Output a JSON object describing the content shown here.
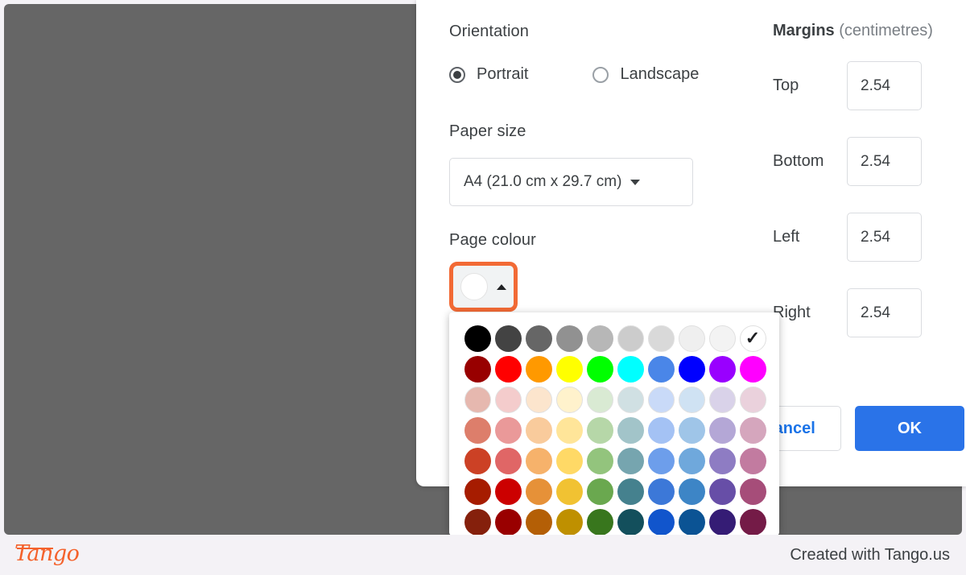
{
  "dialog": {
    "orientation": {
      "label": "Orientation",
      "options": [
        {
          "label": "Portrait",
          "selected": true
        },
        {
          "label": "Landscape",
          "selected": false
        }
      ]
    },
    "paper_size": {
      "label": "Paper size",
      "value": "A4 (21.0 cm x 29.7 cm)"
    },
    "page_colour": {
      "label": "Page colour",
      "current_colour": "#ffffff"
    },
    "margins": {
      "title_bold": "Margins",
      "title_unit": " (centimetres)",
      "fields": [
        {
          "label": "Top",
          "value": "2.54"
        },
        {
          "label": "Bottom",
          "value": "2.54"
        },
        {
          "label": "Left",
          "value": "2.54"
        },
        {
          "label": "Right",
          "value": "2.54"
        }
      ]
    },
    "buttons": {
      "cancel": "Cancel",
      "ok": "OK"
    }
  },
  "palette": {
    "selected_index": 9,
    "check_glyph": "✓",
    "rows": [
      [
        "#000000",
        "#434343",
        "#666666",
        "#919191",
        "#b7b7b7",
        "#cccccc",
        "#d9d9d9",
        "#efefef",
        "#f3f3f3",
        "#ffffff"
      ],
      [
        "#980000",
        "#ff0000",
        "#ff9900",
        "#ffff00",
        "#00ff00",
        "#00ffff",
        "#4a86e8",
        "#0000ff",
        "#9900ff",
        "#ff00ff"
      ],
      [
        "#e6b8af",
        "#f4cccc",
        "#fce5cd",
        "#fff2cc",
        "#d9ead3",
        "#d0e0e3",
        "#c9daf8",
        "#cfe2f3",
        "#d9d2e9",
        "#ead1dc"
      ],
      [
        "#dd7e6b",
        "#ea9999",
        "#f9cb9c",
        "#ffe599",
        "#b6d7a8",
        "#a2c4c9",
        "#a4c2f4",
        "#9fc5e8",
        "#b4a7d6",
        "#d5a6bd"
      ],
      [
        "#cc4125",
        "#e06666",
        "#f6b26b",
        "#ffd966",
        "#93c47d",
        "#76a5af",
        "#6d9eeb",
        "#6fa8dc",
        "#8e7cc3",
        "#c27ba0"
      ],
      [
        "#a61c00",
        "#cc0000",
        "#e69138",
        "#f1c232",
        "#6aa84f",
        "#45818e",
        "#3c78d8",
        "#3d85c6",
        "#674ea7",
        "#a64d79"
      ],
      [
        "#85200c",
        "#990000",
        "#b45f06",
        "#bf9000",
        "#38761d",
        "#134f5c",
        "#1155cc",
        "#0b5394",
        "#351c75",
        "#741b47"
      ]
    ]
  },
  "footer": {
    "logo": "Tango",
    "credit": "Created with Tango.us"
  },
  "colors": {
    "accent_blue": "#2a73e8",
    "highlight_orange": "#f26a35",
    "backdrop_gray": "#666666",
    "page_bg": "#f4f2f6"
  }
}
